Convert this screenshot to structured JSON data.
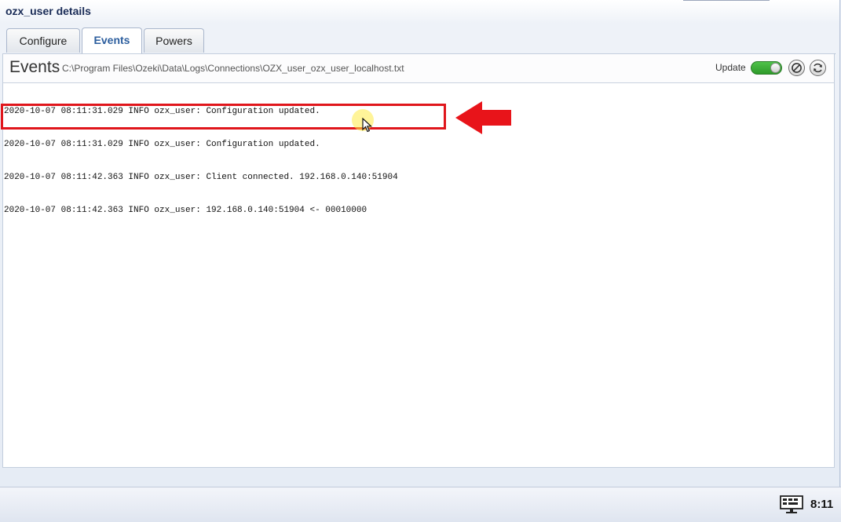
{
  "window": {
    "title": "ozx_user details"
  },
  "tabs": [
    {
      "label": "Configure",
      "active": false
    },
    {
      "label": "Events",
      "active": true
    },
    {
      "label": "Powers",
      "active": false
    }
  ],
  "events": {
    "title": "Events",
    "path": "C:\\Program Files\\Ozeki\\Data\\Logs\\Connections\\OZX_user_ozx_user_localhost.txt",
    "update_label": "Update",
    "update_on": true
  },
  "log_lines": [
    "2020-10-07 08:11:31.029 INFO ozx_user: Configuration updated.",
    "2020-10-07 08:11:31.029 INFO ozx_user: Configuration updated.",
    "2020-10-07 08:11:42.363 INFO ozx_user: Client connected. 192.168.0.140:51904",
    "2020-10-07 08:11:42.363 INFO ozx_user: 192.168.0.140:51904 <- 00010000"
  ],
  "taskbar": {
    "clock": "8:11"
  },
  "icons": {
    "clear": "block-icon",
    "refresh": "refresh-icon",
    "annotation": "red-arrow-icon",
    "tray": "monitor-icon"
  },
  "colors": {
    "accent": "#2c5e9e",
    "toggle_on": "#3aaa35",
    "annotation": "#e0161c"
  }
}
